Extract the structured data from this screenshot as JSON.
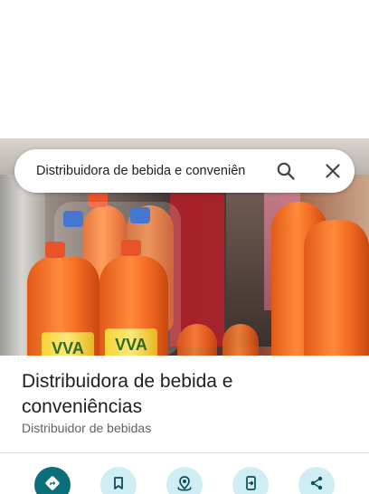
{
  "search": {
    "query": "Distribuidora de bebida e conveniên"
  },
  "place": {
    "name": "Distribuidora de bebida e conveniências",
    "category": "Distribuidor de bebidas"
  },
  "photo": {
    "label_text": "VVA"
  },
  "actions": [
    {
      "icon": "directions-icon"
    },
    {
      "icon": "save-icon"
    },
    {
      "icon": "nearby-icon"
    },
    {
      "icon": "send-to-phone-icon"
    },
    {
      "icon": "share-icon"
    }
  ],
  "colors": {
    "accent": "#0b6f79",
    "action_bg": "#cfeef4",
    "text": "#1f1f1f",
    "muted": "#5f6368"
  }
}
